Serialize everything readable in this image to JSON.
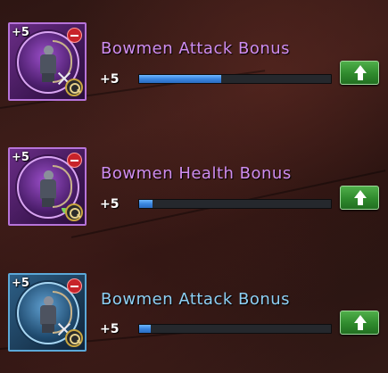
{
  "bonuses": [
    {
      "tile_level": "+5",
      "title": "Bowmen Attack Bonus",
      "level": "+5",
      "progress": 0.43,
      "tier": "purple",
      "icons": [
        "bowman-portrait-icon",
        "remove-icon",
        "magnifier-icon",
        "crossed-swords-icon"
      ],
      "upgrade_icon": "upgrade-arrow-icon"
    },
    {
      "tile_level": "+5",
      "title": "Bowmen Health Bonus",
      "level": "+5",
      "progress": 0.07,
      "tier": "purple",
      "icons": [
        "bowman-portrait-icon",
        "remove-icon",
        "magnifier-icon",
        "leaf-icon"
      ],
      "upgrade_icon": "upgrade-arrow-icon"
    },
    {
      "tile_level": "+5",
      "title": "Bowmen Attack Bonus",
      "level": "+5",
      "progress": 0.06,
      "tier": "blue",
      "icons": [
        "bowman-portrait-icon",
        "remove-icon",
        "magnifier-icon",
        "crossed-swords-icon"
      ],
      "upgrade_icon": "upgrade-arrow-icon"
    }
  ],
  "colors": {
    "purple_title": "#cf8df0",
    "blue_title": "#8ed0f5",
    "bar_fill": "#3a86e0",
    "upgrade_button": "#2f8a2d"
  }
}
